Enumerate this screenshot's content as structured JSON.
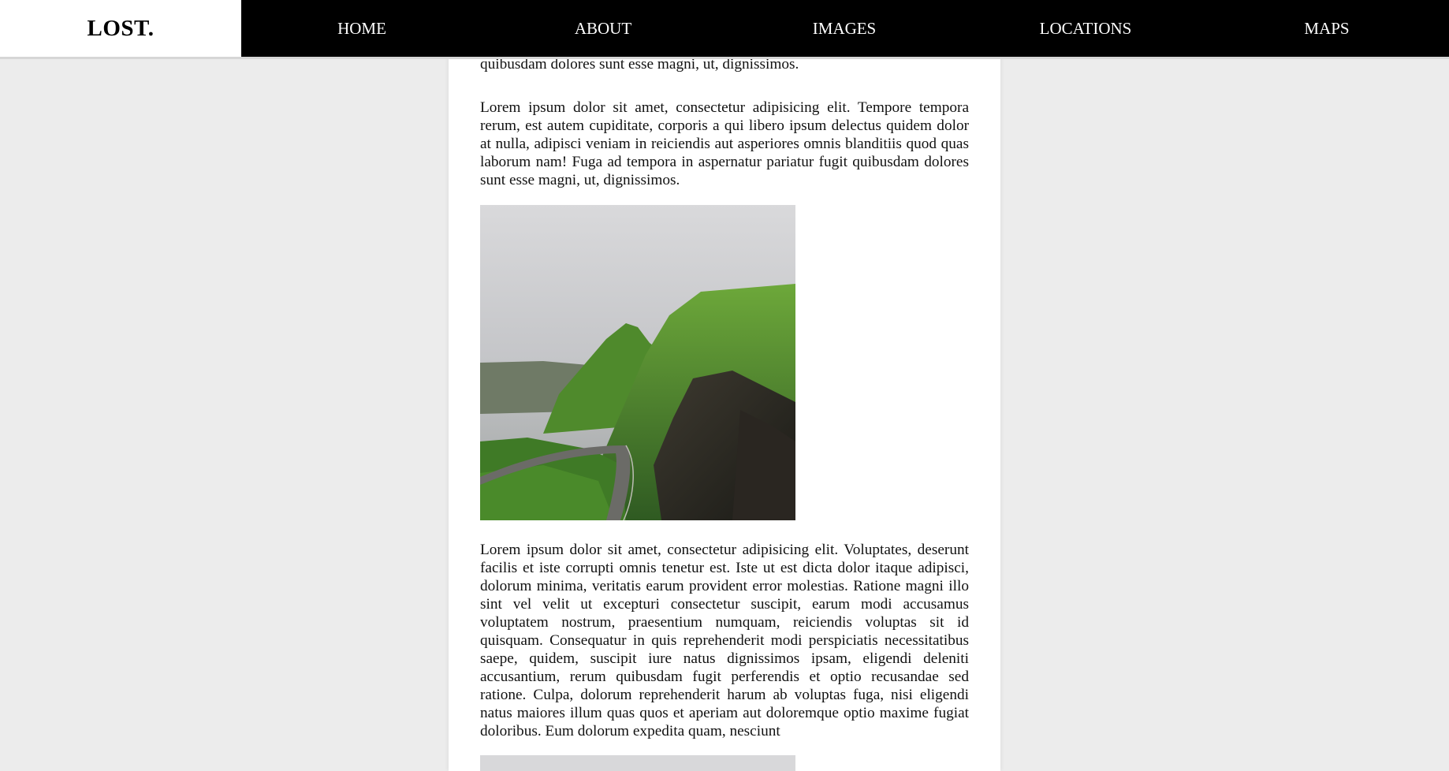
{
  "nav": {
    "logo": "LOST.",
    "items": [
      {
        "label": "HOME"
      },
      {
        "label": "ABOUT"
      },
      {
        "label": "IMAGES"
      },
      {
        "label": "LOCATIONS"
      },
      {
        "label": "MAPS"
      }
    ]
  },
  "content": {
    "paragraph_top_partial": "quod quas laborum nam! Fuga ad tempora in aspernatur pariatur fugit quibusdam dolores sunt esse magni, ut, dignissimos.",
    "paragraph_1": "Lorem ipsum dolor sit amet, consectetur adipisicing elit. Tempore tempora rerum, est autem cupiditate, corporis a qui libero ipsum delectus quidem dolor at nulla, adipisci veniam in reiciendis aut asperiores omnis blanditiis quod quas laborum nam! Fuga ad tempora in aspernatur pariatur fugit quibusdam dolores sunt esse magni, ut, dignissimos.",
    "paragraph_2": "Lorem ipsum dolor sit amet, consectetur adipisicing elit. Voluptates, deserunt facilis et iste corrupti omnis tenetur est. Iste ut est dicta dolor itaque adipisci, dolorum minima, veritatis earum provident error molestias. Ratione magni illo sint vel velit ut excepturi consectetur suscipit, earum modi accusamus voluptatem nostrum, praesentium numquam, reiciendis voluptas sit id quisquam. Consequatur in quis reprehenderit modi perspiciatis necessitatibus saepe, quidem, suscipit iure natus dignissimos ipsam, eligendi deleniti accusantium, rerum quibusdam fugit perferendis et optio recusandae sed ratione. Culpa, dolorum reprehenderit harum ab voluptas fuga, nisi eligendi natus maiores illum quas quos et aperiam aut doloremque optio maxime fugiat doloribus. Eum dolorum expedita quam, nesciunt"
  },
  "colors": {
    "nav_bg": "#000000",
    "page_bg": "#ececec",
    "content_bg": "#ffffff"
  }
}
